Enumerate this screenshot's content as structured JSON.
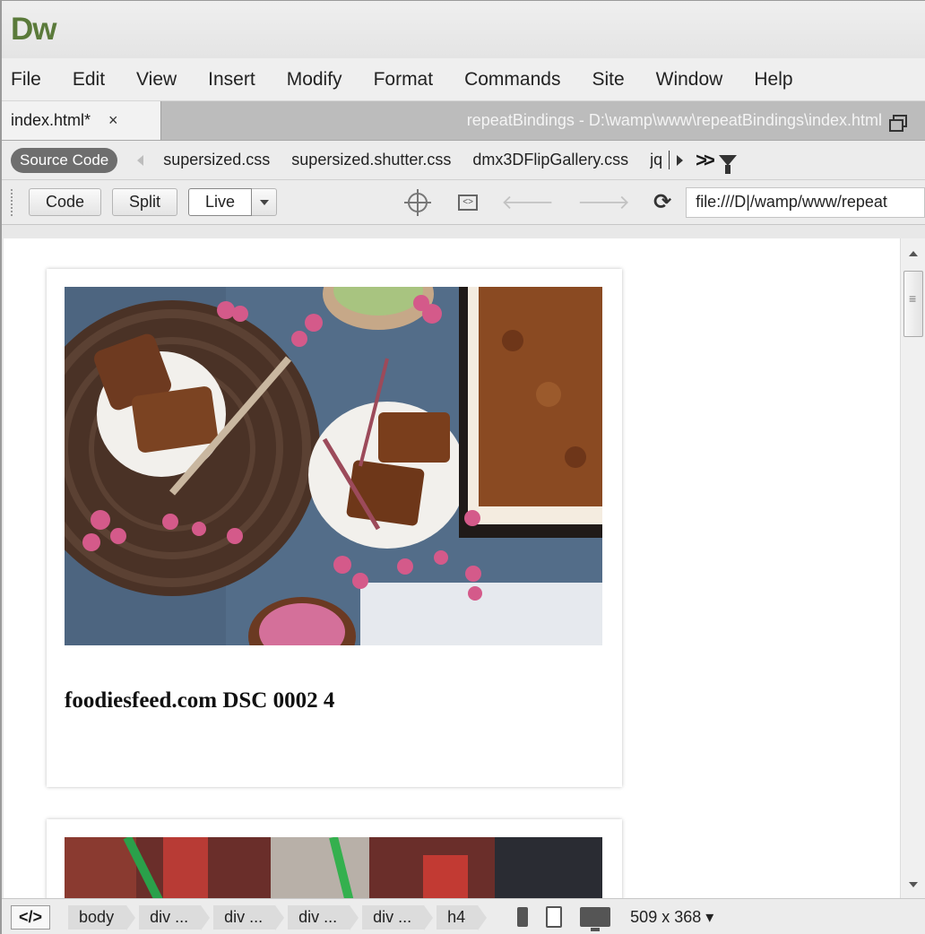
{
  "app": {
    "logo": "Dw"
  },
  "menubar": {
    "items": [
      "File",
      "Edit",
      "View",
      "Insert",
      "Modify",
      "Format",
      "Commands",
      "Site",
      "Window",
      "Help"
    ]
  },
  "doc_tab": {
    "name": "index.html*",
    "close": "×",
    "path": "repeatBindings - D:\\wamp\\www\\repeatBindings\\index.html"
  },
  "related_files": {
    "source_label": "Source Code",
    "files": [
      "supersized.css",
      "supersized.shutter.css",
      "dmx3DFlipGallery.css",
      "jq"
    ]
  },
  "toolbar": {
    "code_label": "Code",
    "split_label": "Split",
    "live_label": "Live",
    "address": "file:///D|/wamp/www/repeat"
  },
  "content": {
    "cards": [
      {
        "title": "foodiesfeed.com DSC 0002 4"
      }
    ]
  },
  "statusbar": {
    "root_tag": "</>",
    "crumbs": [
      "body",
      "div ...",
      "div ...",
      "div ...",
      "div ...",
      "h4"
    ],
    "size": "509 x 368 ▾"
  },
  "colors": {
    "logo": "#5a7a3a",
    "doctab_bar": "#bcbcbc",
    "source_pill": "#6e6e6e"
  }
}
